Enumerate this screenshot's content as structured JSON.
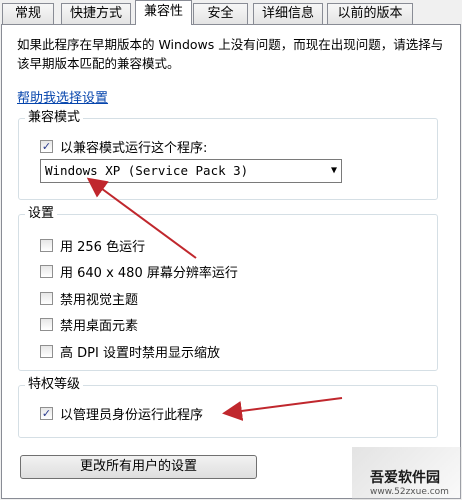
{
  "tabs": [
    {
      "label": "常规"
    },
    {
      "label": "快捷方式"
    },
    {
      "label": "兼容性"
    },
    {
      "label": "安全"
    },
    {
      "label": "详细信息"
    },
    {
      "label": "以前的版本"
    }
  ],
  "intro": "如果此程序在早期版本的 Windows 上没有问题，而现在出现问题，请选择与该早期版本匹配的兼容模式。",
  "help_link": "帮助我选择设置",
  "compat_group": {
    "title": "兼容模式",
    "checkbox_label": "以兼容模式运行这个程序:",
    "checked": true,
    "selected_os": "Windows XP (Service Pack 3)"
  },
  "settings_group": {
    "title": "设置",
    "items": [
      {
        "label": "用 256 色运行",
        "checked": false
      },
      {
        "label": "用 640 x 480 屏幕分辨率运行",
        "checked": false
      },
      {
        "label": "禁用视觉主题",
        "checked": false
      },
      {
        "label": "禁用桌面元素",
        "checked": false
      },
      {
        "label": "高 DPI 设置时禁用显示缩放",
        "checked": false
      }
    ]
  },
  "privilege_group": {
    "title": "特权等级",
    "checkbox_label": "以管理员身份运行此程序",
    "checked": true
  },
  "all_users_button": "更改所有用户的设置",
  "watermark": {
    "text": "吾爱软件园",
    "url": "www.52zxue.com"
  },
  "colors": {
    "arrow": "#c0272d",
    "link": "#0645ad"
  }
}
